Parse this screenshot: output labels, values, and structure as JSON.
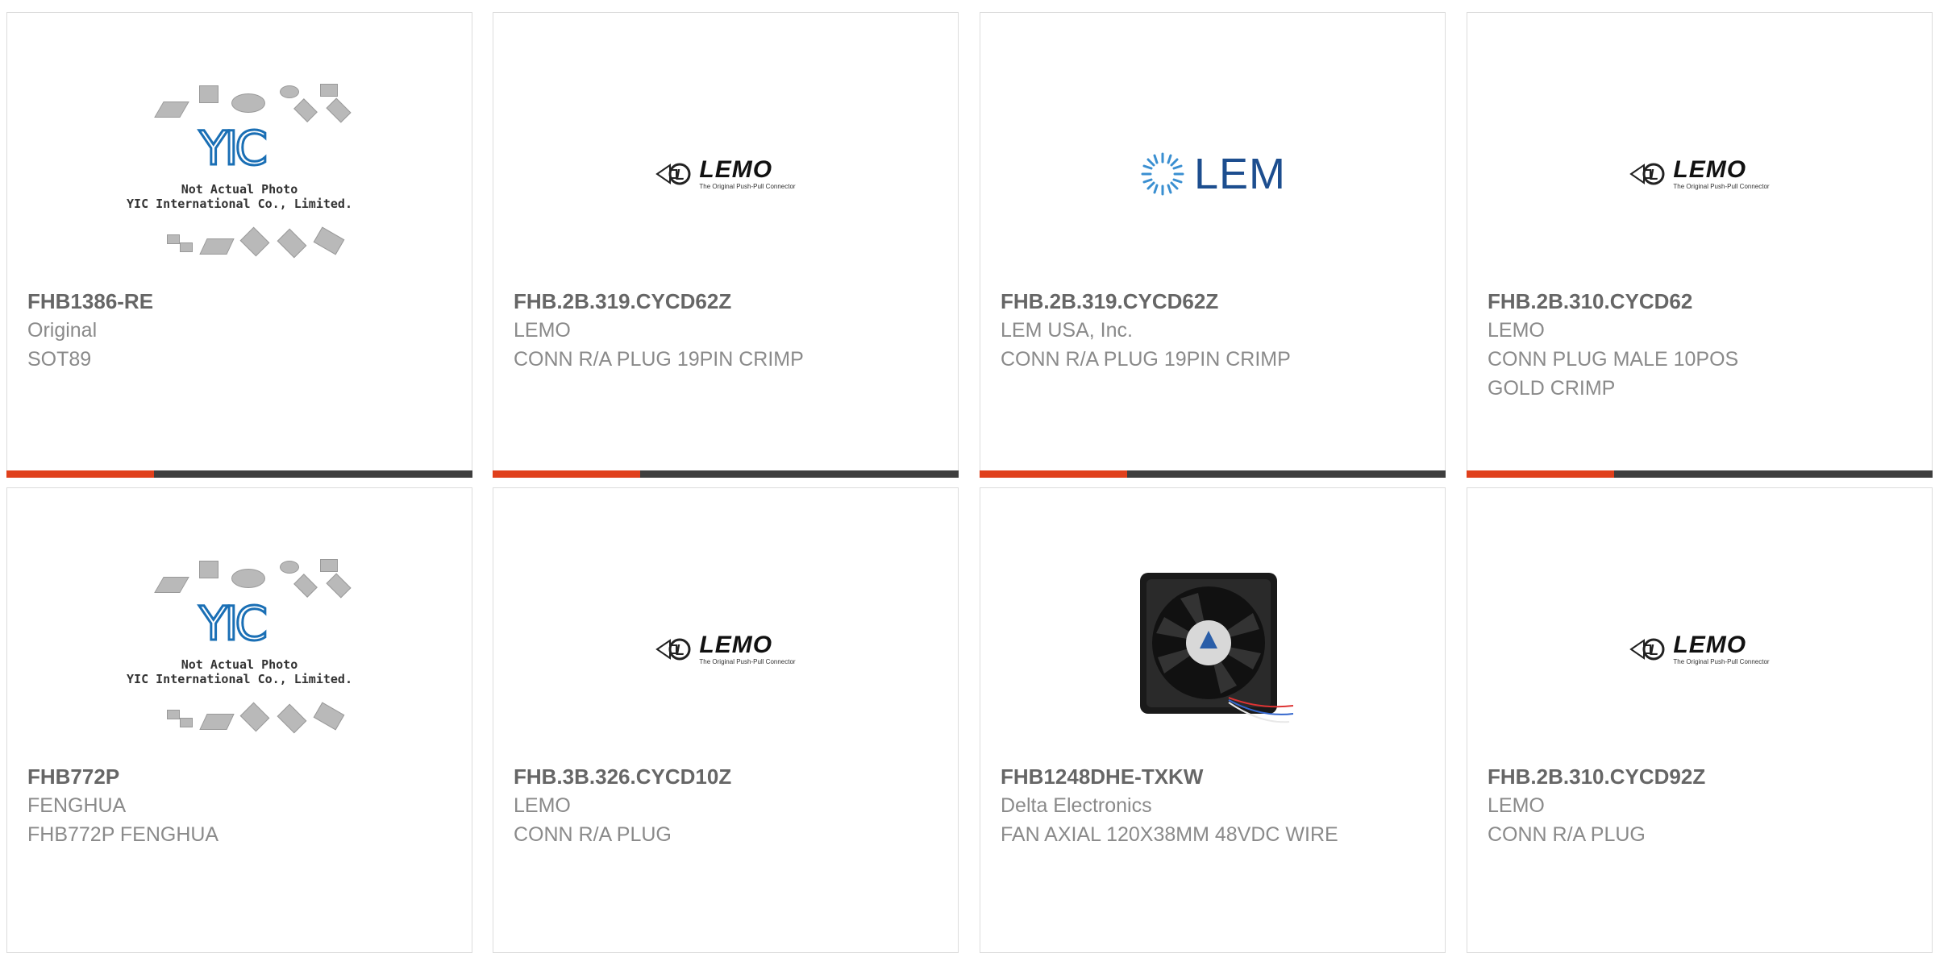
{
  "products": [
    {
      "part": "FHB1386-RE",
      "manufacturer": "Original",
      "description": "SOT89",
      "image": "yic-placeholder"
    },
    {
      "part": "FHB.2B.319.CYCD62Z",
      "manufacturer": "LEMO",
      "description": "CONN R/A PLUG 19PIN CRIMP",
      "image": "lemo-logo"
    },
    {
      "part": "FHB.2B.319.CYCD62Z",
      "manufacturer": "LEM USA, Inc.",
      "description": "CONN R/A PLUG 19PIN CRIMP",
      "image": "lem-logo"
    },
    {
      "part": "FHB.2B.310.CYCD62",
      "manufacturer": "LEMO",
      "description": "CONN PLUG MALE 10POS GOLD CRIMP",
      "image": "lemo-logo"
    },
    {
      "part": "FHB772P",
      "manufacturer": "FENGHUA",
      "description": "FHB772P FENGHUA",
      "image": "yic-placeholder"
    },
    {
      "part": "FHB.3B.326.CYCD10Z",
      "manufacturer": "LEMO",
      "description": "CONN R/A PLUG",
      "image": "lemo-logo"
    },
    {
      "part": "FHB1248DHE-TXKW",
      "manufacturer": "Delta Electronics",
      "description": "FAN AXIAL 120X38MM 48VDC WIRE",
      "image": "fan-photo"
    },
    {
      "part": "FHB.2B.310.CYCD92Z",
      "manufacturer": "LEMO",
      "description": "CONN R/A PLUG",
      "image": "lemo-logo"
    }
  ],
  "logos": {
    "lemo_text": "LEMO",
    "lemo_tagline": "The Original Push-Pull Connector",
    "lem_text": "LEM",
    "yic_letters": "YIC",
    "yic_note_line1": "Not Actual Photo",
    "yic_note_line2": "YIC International Co., Limited."
  },
  "colors": {
    "accent": "#e0401c",
    "bar": "#3e3e3e",
    "lem_blue": "#1d4e8f",
    "yic_blue": "#1a6fb5"
  }
}
